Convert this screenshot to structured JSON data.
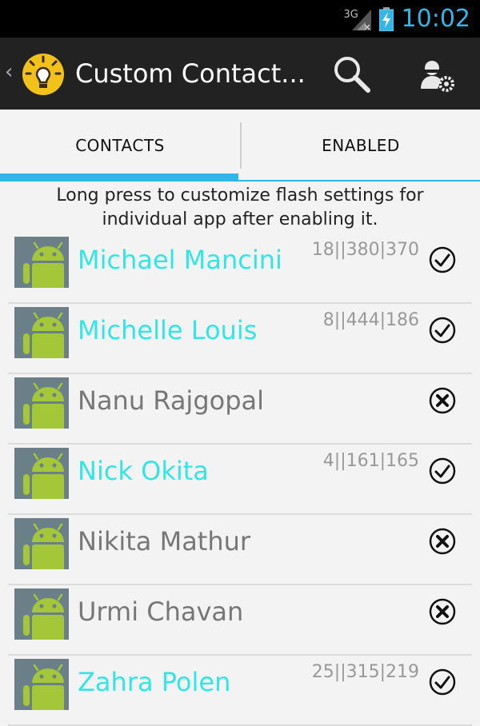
{
  "status_bar": {
    "network": "3G",
    "time": "10:02"
  },
  "action_bar": {
    "title": "Custom Contact..."
  },
  "tabs": [
    {
      "label": "CONTACTS",
      "selected": true
    },
    {
      "label": "ENABLED",
      "selected": false
    }
  ],
  "hint": "Long press to customize flash settings for individual app after enabling it.",
  "colors": {
    "accent": "#33b5e5",
    "enabled_name": "#33e5e5",
    "disabled_name": "#777777",
    "android_green": "#a4c639"
  },
  "contacts": [
    {
      "name": "Michael Mancini",
      "stats": "18||380|370",
      "enabled": true,
      "state_icon": "check-circle-icon"
    },
    {
      "name": "Michelle Louis",
      "stats": "8||444|186",
      "enabled": true,
      "state_icon": "check-circle-icon"
    },
    {
      "name": "Nanu Rajgopal",
      "stats": "",
      "enabled": false,
      "state_icon": "x-circle-icon"
    },
    {
      "name": "Nick Okita",
      "stats": "4||161|165",
      "enabled": true,
      "state_icon": "check-circle-icon"
    },
    {
      "name": "Nikita Mathur",
      "stats": "",
      "enabled": false,
      "state_icon": "x-circle-icon"
    },
    {
      "name": "Urmi Chavan",
      "stats": "",
      "enabled": false,
      "state_icon": "x-circle-icon"
    },
    {
      "name": "Zahra Polen",
      "stats": "25||315|219",
      "enabled": true,
      "state_icon": "check-circle-icon"
    }
  ]
}
